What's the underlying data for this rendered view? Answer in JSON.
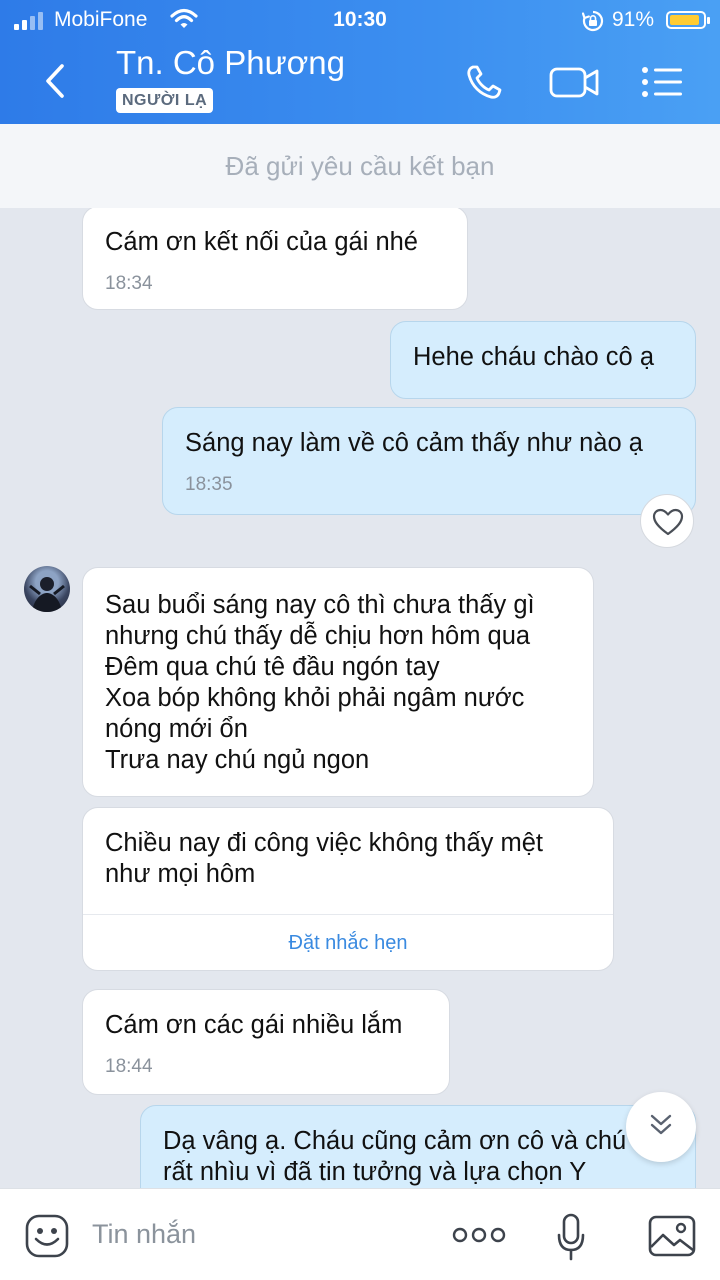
{
  "status_bar": {
    "carrier": "MobiFone",
    "time": "10:30",
    "battery": "91%",
    "battery_level": 0.91
  },
  "header": {
    "name": "Tn. Cô Phương",
    "badge": "NGƯỜI LẠ"
  },
  "friend_request": "Đã gửi yêu cầu kết bạn",
  "messages": [
    {
      "dir": "in",
      "text": "Cám ơn kết nối của gái nhé",
      "time": "18:34"
    },
    {
      "dir": "out",
      "text": "Hehe cháu chào cô ạ"
    },
    {
      "dir": "out",
      "text": "Sáng nay làm về cô cảm thấy như nào ạ",
      "time": "18:35"
    },
    {
      "dir": "in",
      "text": "Sau buổi sáng nay cô thì chưa thấy gì\nnhưng chú thấy dễ chịu hơn hôm qua\nĐêm qua chú tê đầu ngón tay\nXoa bóp không khỏi phải ngâm nước\nnóng mới ổn\nTrưa nay chú ngủ ngon"
    },
    {
      "dir": "in",
      "text": "Chiều nay đi công việc không thấy mệt\nnhư mọi hôm",
      "action": "Đặt nhắc hẹn"
    },
    {
      "dir": "in",
      "text": "Cám ơn các gái nhiều lắm",
      "time": "18:44"
    },
    {
      "dir": "out",
      "text": "Dạ vâng ạ. Cháu cũng cảm ơn cô và chú\nrất nhìu vì đã tin tưởng và lựa chọn Y"
    }
  ],
  "input": {
    "placeholder": "Tin nhắn"
  },
  "colors": {
    "header": "#3c8ff0",
    "outgoing": "#d5edfd",
    "incoming": "#ffffff",
    "link": "#3a8ae0"
  }
}
